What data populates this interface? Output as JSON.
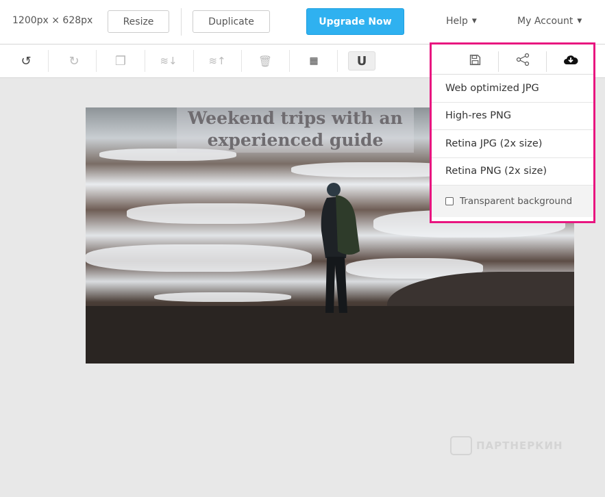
{
  "header": {
    "canvas_size": "1200px × 628px",
    "resize_label": "Resize",
    "duplicate_label": "Duplicate",
    "upgrade_label": "Upgrade Now",
    "help_label": "Help",
    "account_label": "My Account"
  },
  "toolbar": {
    "tools": [
      "undo-icon",
      "redo-icon",
      "copy-icon",
      "layer-down-icon",
      "layer-up-icon",
      "trash-icon",
      "grid-icon",
      "magnet-icon"
    ]
  },
  "canvas": {
    "headline_line1": "Weekend trips with an",
    "headline_line2": "experienced guide"
  },
  "download_menu": {
    "highlight_color": "#e8147f",
    "icons": [
      "save-icon",
      "share-icon",
      "cloud-download-icon"
    ],
    "items": [
      "Web optimized JPG",
      "High-res PNG",
      "Retina JPG (2x size)",
      "Retina PNG (2x size)"
    ],
    "transparent_label": "Transparent background",
    "transparent_checked": false
  },
  "watermark": {
    "text": "ПАРТНЕРКИН"
  },
  "colors": {
    "upgrade": "#2fb1f0"
  }
}
